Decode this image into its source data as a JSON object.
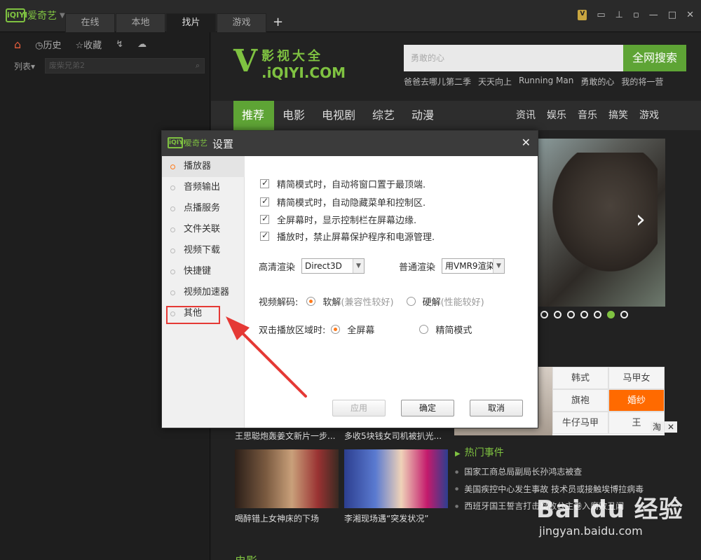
{
  "app": {
    "logo_box": "iQIYI",
    "logo_text": "爱奇艺"
  },
  "tabs": [
    "在线",
    "本地",
    "找片",
    "游戏"
  ],
  "tab_add": "+",
  "left": {
    "history": "历史",
    "favorites": "收藏",
    "list_label": "列表",
    "search_placeholder": "废柴兄弟2"
  },
  "content": {
    "brand_v": "V",
    "brand_line1": "影视大全",
    "brand_line2": ".iQIYI.COM",
    "search_placeholder": "勇敢的心",
    "search_button": "全网搜索",
    "hotwords": [
      "爸爸去哪儿第二季",
      "天天向上",
      "Running Man",
      "勇敢的心",
      "我的将一营"
    ],
    "nav_main": [
      "推荐",
      "电影",
      "电视剧",
      "综艺",
      "动漫"
    ],
    "nav_sub": [
      "资讯",
      "娱乐",
      "音乐",
      "搞笑",
      "游戏"
    ],
    "tags": [
      "韩式",
      "马甲女",
      "旗袍",
      "婚纱",
      "牛仔马甲",
      "王"
    ],
    "tb_label": "淘",
    "captions": [
      "王思聪炮轰姜文新片一步...",
      "多收5块钱女司机被扒光...",
      "喝醉错上女神床的下场",
      "李湘现场遇“突发状况”"
    ],
    "hot_events_title": "热门事件",
    "hot_events": [
      "国家工商总局副局长孙鸿志被查",
      "美国疾控中心发生事故 技术员或接触埃博拉病毒",
      "西班牙国王誓言打击腐败公主卷入腐败丑闻"
    ],
    "bottom_title": "电影"
  },
  "dialog": {
    "logo_box": "iQIYI",
    "logo_text": "爱奇艺",
    "title": "设置",
    "sidebar": [
      "播放器",
      "音频输出",
      "点播服务",
      "文件关联",
      "视频下载",
      "快捷键",
      "视频加速器",
      "其他"
    ],
    "checkboxes": [
      "精简模式时，自动将窗口置于最顶端.",
      "精简模式时，自动隐藏菜单和控制区.",
      "全屏幕时，显示控制栏在屏幕边缘.",
      "播放时，禁止屏幕保护程序和电源管理."
    ],
    "hd_render_label": "高清渲染",
    "hd_render_value": "Direct3D",
    "sd_render_label": "普通渲染",
    "sd_render_value": "用VMR9渲染",
    "decode_label": "视频解码:",
    "decode_soft": "软解",
    "decode_soft_hint": "(兼容性较好)",
    "decode_hard": "硬解",
    "decode_hard_hint": "(性能较好)",
    "dblclick_label": "双击播放区域时:",
    "dblclick_full": "全屏幕",
    "dblclick_mini": "精简模式",
    "btn_apply": "应用",
    "btn_ok": "确定",
    "btn_cancel": "取消"
  },
  "watermark": {
    "line1": "Bai du 经验",
    "line2": "jingyan.baidu.com"
  },
  "colors": {
    "accent_green": "#7fc241",
    "search_green": "#5ea435",
    "highlight_red": "#e53935",
    "radio_orange": "#ff7a1a"
  }
}
